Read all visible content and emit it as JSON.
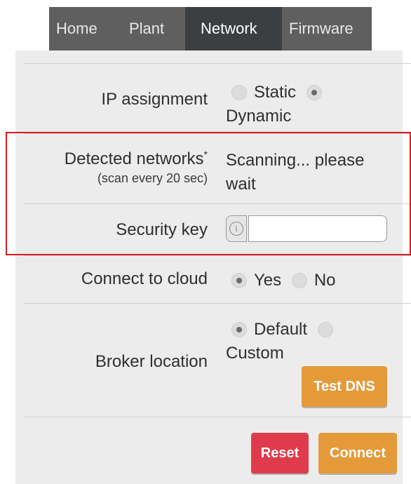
{
  "nav": {
    "tabs": [
      {
        "label": "Home"
      },
      {
        "label": "Plant"
      },
      {
        "label": "Network"
      },
      {
        "label": "Firmware"
      }
    ]
  },
  "form": {
    "ip": {
      "label": "IP assignment",
      "opt_static": "Static",
      "opt_dynamic": "Dynamic",
      "selected": "Dynamic"
    },
    "networks": {
      "label": "Detected networks",
      "required_mark": "*",
      "sublabel": "(scan every 20 sec)",
      "status": "Scanning... please wait"
    },
    "security": {
      "label": "Security key",
      "icon": "info-icon",
      "value": ""
    },
    "cloud": {
      "label": "Connect to cloud",
      "opt_yes": "Yes",
      "opt_no": "No",
      "selected": "Yes"
    },
    "broker": {
      "label": "Broker location",
      "opt_default": "Default",
      "opt_custom": "Custom",
      "selected": "Default",
      "test_dns_label": "Test DNS"
    },
    "actions": {
      "reset_label": "Reset",
      "connect_label": "Connect"
    }
  },
  "colors": {
    "nav_bg": "#5f5f5f",
    "nav_active": "#3c3f42",
    "panel_bg": "#ececec",
    "orange": "#e59a39",
    "red": "#df3b4c",
    "highlight": "#d81b1b"
  }
}
